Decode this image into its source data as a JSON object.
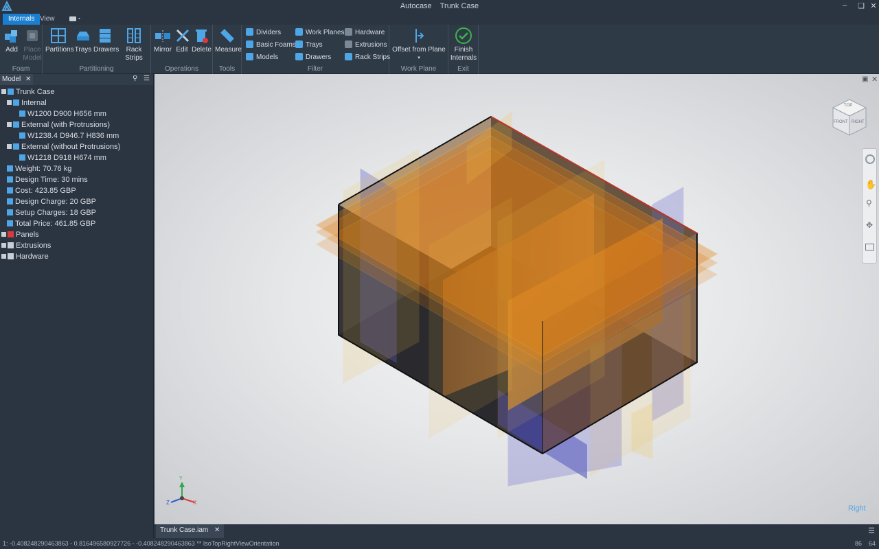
{
  "title": {
    "app": "Autocase",
    "document": "Trunk Case"
  },
  "tabs": {
    "internals": "Internals",
    "view": "View"
  },
  "ribbon": {
    "foam": {
      "label": "Foam",
      "add": "Add",
      "place_model": "Place Model"
    },
    "partitioning": {
      "label": "Partitioning",
      "partitions": "Partitions",
      "trays": "Trays",
      "drawers": "Drawers",
      "rack_strips": "Rack Strips"
    },
    "operations": {
      "label": "Operations",
      "mirror": "Mirror",
      "edit": "Edit",
      "delete": "Delete"
    },
    "tools": {
      "label": "Tools",
      "measure": "Measure"
    },
    "filter": {
      "label": "Filter",
      "dividers": "Dividers",
      "basic_foams": "Basic Foams",
      "models": "Models",
      "work_planes": "Work Planes",
      "trays": "Trays",
      "drawers": "Drawers",
      "hardware": "Hardware",
      "extrusions": "Extrusions",
      "rack_strips": "Rack Strips"
    },
    "work_plane": {
      "label": "Work Plane",
      "offset": "Offset from Plane"
    },
    "exit": {
      "label": "Exit",
      "finish": "Finish Internals"
    }
  },
  "model_panel": {
    "tab": "Model",
    "tree": [
      {
        "label": "Trunk Case",
        "level": 0
      },
      {
        "label": "Internal",
        "level": 1
      },
      {
        "label": "W1200 D900 H656 mm",
        "level": 2
      },
      {
        "label": "External (with Protrusions)",
        "level": 1
      },
      {
        "label": "W1238.4 D946.7 H836 mm",
        "level": 2
      },
      {
        "label": "External (without Protrusions)",
        "level": 1
      },
      {
        "label": "W1218 D918 H674 mm",
        "level": 2
      },
      {
        "label": "Weight: 70.76 kg",
        "level": 1
      },
      {
        "label": "Design Time: 30 mins",
        "level": 1
      },
      {
        "label": "Cost: 423.85 GBP",
        "level": 1
      },
      {
        "label": "Design Charge: 20 GBP",
        "level": 1
      },
      {
        "label": "Setup Charges: 18 GBP",
        "level": 1
      },
      {
        "label": "Total Price: 461.85 GBP",
        "level": 1
      },
      {
        "label": "Panels",
        "level": 0
      },
      {
        "label": "Extrusions",
        "level": 0
      },
      {
        "label": "Hardware",
        "level": 0
      }
    ]
  },
  "viewcube": {
    "top": "TOP",
    "front": "FRONT",
    "right": "RIGHT"
  },
  "axes": {
    "x": "X",
    "y": "Y",
    "z": "Z"
  },
  "view_label": "Right",
  "doc_tab": "Trunk Case.iam",
  "status": {
    "text": "1: -0.408248290463863 - 0.816496580927726 - -0.408248290463863 ** IsoTopRightViewOrientation",
    "n1": "86",
    "n2": "64"
  }
}
